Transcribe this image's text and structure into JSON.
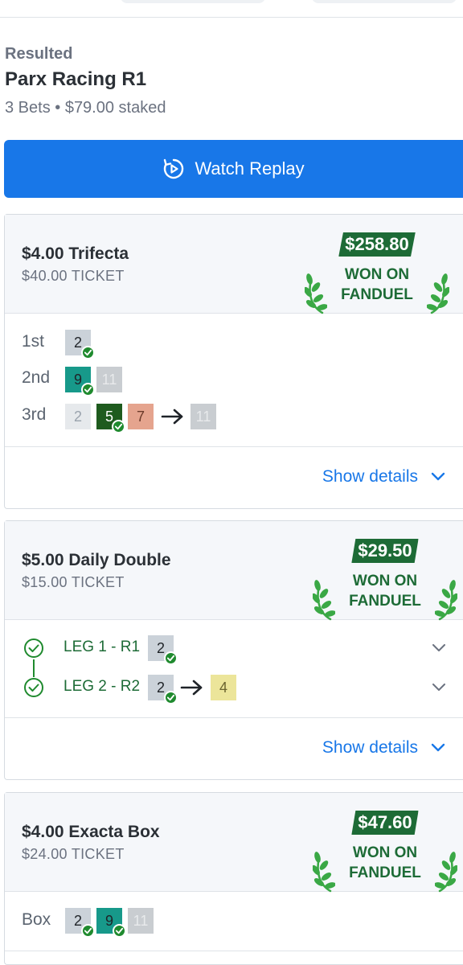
{
  "header": {
    "status": "Resulted",
    "race": "Parx Racing R1",
    "summary": "3 Bets • $79.00 staked"
  },
  "replay": {
    "label": "Watch Replay"
  },
  "won_label_line1": "WON ON",
  "won_label_line2": "FANDUEL",
  "show_details_label": "Show details",
  "bets": [
    {
      "name": "$4.00 Trifecta",
      "ticket": "$40.00 TICKET",
      "won_amount": "$258.80",
      "rows": [
        {
          "label": "1st",
          "chips": [
            "2"
          ]
        },
        {
          "label": "2nd",
          "chips": [
            "9",
            "11"
          ]
        },
        {
          "label": "3rd",
          "chips": [
            "2",
            "5",
            "7",
            "11"
          ]
        }
      ]
    },
    {
      "name": "$5.00 Daily Double",
      "ticket": "$15.00 TICKET",
      "won_amount": "$29.50",
      "legs": [
        {
          "label": "LEG 1 - R1",
          "chips": [
            "2"
          ]
        },
        {
          "label": "LEG 2 - R2",
          "chips": [
            "2",
            "4"
          ]
        }
      ]
    },
    {
      "name": "$4.00 Exacta Box",
      "ticket": "$24.00 TICKET",
      "won_amount": "$47.60",
      "rows": [
        {
          "label": "Box",
          "chips": [
            "2",
            "9",
            "11"
          ]
        }
      ]
    }
  ],
  "colors": {
    "accent_blue": "#1877e8",
    "win_green": "#1d6b36",
    "check_green": "#1f8a2e"
  },
  "icons": [
    "replay-icon",
    "laurel-icon",
    "check-icon",
    "arrow-right-icon",
    "chevron-down-icon",
    "check-circle-icon"
  ]
}
